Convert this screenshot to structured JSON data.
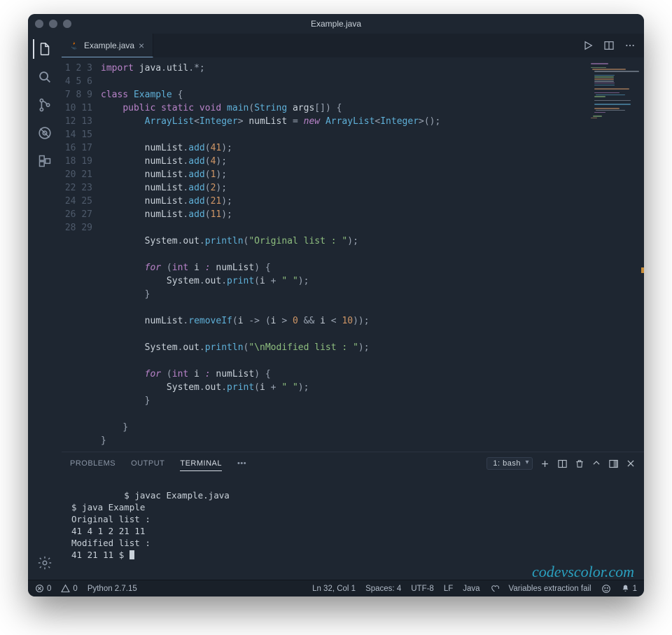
{
  "window": {
    "title": "Example.java"
  },
  "tab": {
    "label": "Example.java"
  },
  "code": {
    "lines": [
      [
        [
          "kw",
          "import"
        ],
        [
          "pun",
          " "
        ],
        [
          "id",
          "java"
        ],
        [
          "dot",
          "."
        ],
        [
          "id",
          "util"
        ],
        [
          "dot",
          "."
        ],
        [
          "op",
          "*"
        ],
        [
          "pun",
          ";"
        ]
      ],
      [],
      [
        [
          "kw",
          "class"
        ],
        [
          "pun",
          " "
        ],
        [
          "typ",
          "Example"
        ],
        [
          "pun",
          " {"
        ]
      ],
      [
        [
          "pun",
          "    "
        ],
        [
          "kw",
          "public"
        ],
        [
          "pun",
          " "
        ],
        [
          "kw",
          "static"
        ],
        [
          "pun",
          " "
        ],
        [
          "kw",
          "void"
        ],
        [
          "pun",
          " "
        ],
        [
          "fn",
          "main"
        ],
        [
          "pun",
          "("
        ],
        [
          "typ",
          "String"
        ],
        [
          "pun",
          " "
        ],
        [
          "id",
          "args"
        ],
        [
          "pun",
          "[]) {"
        ]
      ],
      [
        [
          "pun",
          "        "
        ],
        [
          "typ",
          "ArrayList"
        ],
        [
          "pun",
          "<"
        ],
        [
          "typ",
          "Integer"
        ],
        [
          "pun",
          "> "
        ],
        [
          "id",
          "numList"
        ],
        [
          "pun",
          " = "
        ],
        [
          "kw it",
          "new"
        ],
        [
          "pun",
          " "
        ],
        [
          "typ",
          "ArrayList"
        ],
        [
          "pun",
          "<"
        ],
        [
          "typ",
          "Integer"
        ],
        [
          "pun",
          ">();"
        ]
      ],
      [],
      [
        [
          "pun",
          "        "
        ],
        [
          "id",
          "numList"
        ],
        [
          "dot",
          "."
        ],
        [
          "call",
          "add"
        ],
        [
          "pun",
          "("
        ],
        [
          "num",
          "41"
        ],
        [
          "pun",
          ");"
        ]
      ],
      [
        [
          "pun",
          "        "
        ],
        [
          "id",
          "numList"
        ],
        [
          "dot",
          "."
        ],
        [
          "call",
          "add"
        ],
        [
          "pun",
          "("
        ],
        [
          "num",
          "4"
        ],
        [
          "pun",
          ");"
        ]
      ],
      [
        [
          "pun",
          "        "
        ],
        [
          "id",
          "numList"
        ],
        [
          "dot",
          "."
        ],
        [
          "call",
          "add"
        ],
        [
          "pun",
          "("
        ],
        [
          "num",
          "1"
        ],
        [
          "pun",
          ");"
        ]
      ],
      [
        [
          "pun",
          "        "
        ],
        [
          "id",
          "numList"
        ],
        [
          "dot",
          "."
        ],
        [
          "call",
          "add"
        ],
        [
          "pun",
          "("
        ],
        [
          "num",
          "2"
        ],
        [
          "pun",
          ");"
        ]
      ],
      [
        [
          "pun",
          "        "
        ],
        [
          "id",
          "numList"
        ],
        [
          "dot",
          "."
        ],
        [
          "call",
          "add"
        ],
        [
          "pun",
          "("
        ],
        [
          "num",
          "21"
        ],
        [
          "pun",
          ");"
        ]
      ],
      [
        [
          "pun",
          "        "
        ],
        [
          "id",
          "numList"
        ],
        [
          "dot",
          "."
        ],
        [
          "call",
          "add"
        ],
        [
          "pun",
          "("
        ],
        [
          "num",
          "11"
        ],
        [
          "pun",
          ");"
        ]
      ],
      [],
      [
        [
          "pun",
          "        "
        ],
        [
          "id",
          "System"
        ],
        [
          "dot",
          "."
        ],
        [
          "id",
          "out"
        ],
        [
          "dot",
          "."
        ],
        [
          "call",
          "println"
        ],
        [
          "pun",
          "("
        ],
        [
          "str",
          "\"Original list : \""
        ],
        [
          "pun",
          ");"
        ]
      ],
      [],
      [
        [
          "pun",
          "        "
        ],
        [
          "kw it",
          "for"
        ],
        [
          "pun",
          " ("
        ],
        [
          "kw",
          "int"
        ],
        [
          "pun",
          " "
        ],
        [
          "id",
          "i"
        ],
        [
          "pun",
          " "
        ],
        [
          "kw it",
          ":"
        ],
        [
          "pun",
          " "
        ],
        [
          "id",
          "numList"
        ],
        [
          "pun",
          ") {"
        ]
      ],
      [
        [
          "pun",
          "            "
        ],
        [
          "id",
          "System"
        ],
        [
          "dot",
          "."
        ],
        [
          "id",
          "out"
        ],
        [
          "dot",
          "."
        ],
        [
          "call",
          "print"
        ],
        [
          "pun",
          "("
        ],
        [
          "id",
          "i"
        ],
        [
          "pun",
          " + "
        ],
        [
          "str",
          "\" \""
        ],
        [
          "pun",
          ");"
        ]
      ],
      [
        [
          "pun",
          "        }"
        ]
      ],
      [],
      [
        [
          "pun",
          "        "
        ],
        [
          "id",
          "numList"
        ],
        [
          "dot",
          "."
        ],
        [
          "call",
          "removeIf"
        ],
        [
          "pun",
          "("
        ],
        [
          "id",
          "i"
        ],
        [
          "pun",
          " -> ("
        ],
        [
          "id",
          "i"
        ],
        [
          "pun",
          " > "
        ],
        [
          "num",
          "0"
        ],
        [
          "pun",
          " && "
        ],
        [
          "id",
          "i"
        ],
        [
          "pun",
          " < "
        ],
        [
          "num",
          "10"
        ],
        [
          "pun",
          "));"
        ]
      ],
      [],
      [
        [
          "pun",
          "        "
        ],
        [
          "id",
          "System"
        ],
        [
          "dot",
          "."
        ],
        [
          "id",
          "out"
        ],
        [
          "dot",
          "."
        ],
        [
          "call",
          "println"
        ],
        [
          "pun",
          "("
        ],
        [
          "str",
          "\"\\nModified list : \""
        ],
        [
          "pun",
          ");"
        ]
      ],
      [],
      [
        [
          "pun",
          "        "
        ],
        [
          "kw it",
          "for"
        ],
        [
          "pun",
          " ("
        ],
        [
          "kw",
          "int"
        ],
        [
          "pun",
          " "
        ],
        [
          "id",
          "i"
        ],
        [
          "pun",
          " "
        ],
        [
          "kw it",
          ":"
        ],
        [
          "pun",
          " "
        ],
        [
          "id",
          "numList"
        ],
        [
          "pun",
          ") {"
        ]
      ],
      [
        [
          "pun",
          "            "
        ],
        [
          "id",
          "System"
        ],
        [
          "dot",
          "."
        ],
        [
          "id",
          "out"
        ],
        [
          "dot",
          "."
        ],
        [
          "call",
          "print"
        ],
        [
          "pun",
          "("
        ],
        [
          "id",
          "i"
        ],
        [
          "pun",
          " + "
        ],
        [
          "str",
          "\" \""
        ],
        [
          "pun",
          ");"
        ]
      ],
      [
        [
          "pun",
          "        }"
        ]
      ],
      [],
      [
        [
          "pun",
          "    }"
        ]
      ],
      [
        [
          "pun",
          "}"
        ]
      ]
    ]
  },
  "panel": {
    "tabs": {
      "problems": "PROBLEMS",
      "output": "OUTPUT",
      "terminal": "TERMINAL"
    },
    "select": "1: bash"
  },
  "terminal": {
    "lines": [
      "$ javac Example.java",
      "$ java Example",
      "Original list :",
      "41 4 1 2 21 11",
      "Modified list :",
      "41 21 11 $ "
    ]
  },
  "watermark": "codevscolor.com",
  "status": {
    "errors": "0",
    "warnings": "0",
    "python": "Python 2.7.15",
    "position": "Ln 32, Col 1",
    "spaces": "Spaces: 4",
    "encoding": "UTF-8",
    "eol": "LF",
    "lang": "Java",
    "extract": "Variables extraction fail",
    "bell": "1"
  }
}
